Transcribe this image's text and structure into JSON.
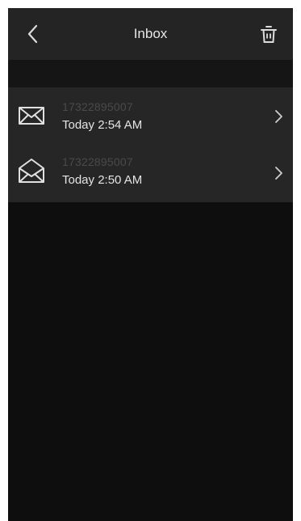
{
  "header": {
    "title": "Inbox",
    "back_icon": "chevron-left-icon",
    "trash_icon": "trash-icon"
  },
  "messages": [
    {
      "sender": "17322895007",
      "time": "Today 2:54 AM",
      "icon": "envelope-closed-icon",
      "read": false
    },
    {
      "sender": "17322895007",
      "time": "Today 2:50 AM",
      "icon": "envelope-open-icon",
      "read": true
    }
  ],
  "colors": {
    "header_bg": "#242424",
    "background": "#0e0e0e",
    "row_bg": "#262626",
    "text": "#e4e4e4",
    "muted_text": "#4a4a4a"
  }
}
